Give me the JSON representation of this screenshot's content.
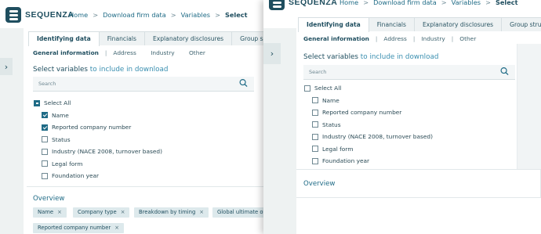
{
  "app": {
    "logo_text": "SEQUENZA"
  },
  "breadcrumb": [
    {
      "label": "Home"
    },
    {
      "label": "Download firm data"
    },
    {
      "label": "Variables"
    },
    {
      "label": "Select"
    }
  ],
  "breadcrumb_sep": ">",
  "left": {
    "tabs": [
      "Identifying data",
      "Financials",
      "Explanatory disclosures",
      "Group s"
    ],
    "subtabs": [
      "General information",
      "Address",
      "Industry",
      "Other"
    ],
    "select_title_strong": "Select variables",
    "select_title_rest": " to include in download",
    "search_placeholder": "Search",
    "select_all": "Select All",
    "items": [
      {
        "label": "Name",
        "checked": true
      },
      {
        "label": "Reported company number",
        "checked": true
      },
      {
        "label": "Status",
        "checked": false
      },
      {
        "label": "Industry (NACE 2008, turnover based)",
        "checked": false
      },
      {
        "label": "Legal form",
        "checked": false
      },
      {
        "label": "Foundation year",
        "checked": false
      }
    ],
    "overview_title": "Overview",
    "chips": [
      "Name",
      "Company type",
      "Breakdown by timing",
      "Global ultimate ow",
      "Reported company number"
    ],
    "chip_close": "×"
  },
  "right": {
    "tabs": [
      "Identifying data",
      "Financials",
      "Explanatory disclosures",
      "Group stru"
    ],
    "subtabs": [
      "General information",
      "Address",
      "Industry",
      "Other"
    ],
    "select_title_strong": "Select variables",
    "select_title_rest": " to include in download",
    "search_placeholder": "Search",
    "select_all": "Select All",
    "items": [
      {
        "label": "Name",
        "checked": false
      },
      {
        "label": "Reported company number",
        "checked": false
      },
      {
        "label": "Status",
        "checked": false
      },
      {
        "label": "Industry (NACE 2008, turnover based)",
        "checked": false
      },
      {
        "label": "Legal form",
        "checked": false
      },
      {
        "label": "Foundation year",
        "checked": false
      }
    ],
    "overview_title": "Overview"
  },
  "icons": {
    "sidebar_toggle": "chevron-right-icon",
    "search": "search-icon",
    "chip_close": "close-icon"
  },
  "colors": {
    "brand": "#1f4e5f",
    "accent": "#1f6b86",
    "chip_bg": "#dde9ec",
    "strip_bg": "#eef2f2"
  }
}
